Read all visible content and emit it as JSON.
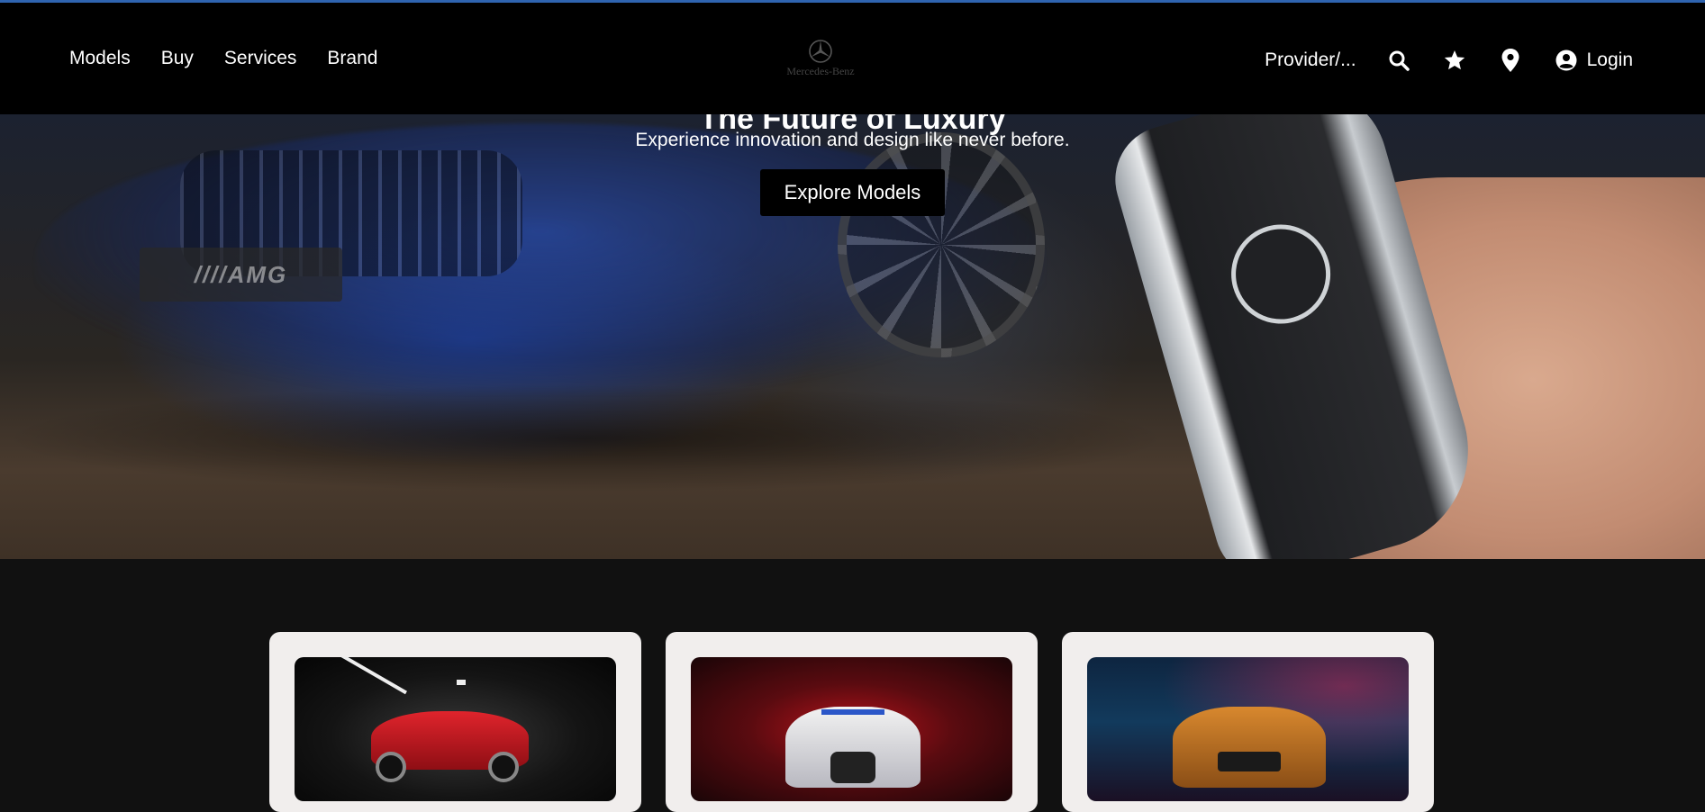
{
  "nav": {
    "links": [
      "Models",
      "Buy",
      "Services",
      "Brand"
    ],
    "logo_text": "Mercedes-Benz",
    "provider": "Provider/...",
    "login": "Login"
  },
  "hero": {
    "title": "The Future of Luxury",
    "subtitle": "Experience innovation and design like never before.",
    "button": "Explore Models",
    "plate_text": "////AMG"
  },
  "cards": [
    {
      "image": "red-sports-car"
    },
    {
      "image": "white-race-car"
    },
    {
      "image": "orange-muscle-car"
    }
  ],
  "icons": [
    "search-icon",
    "star-icon",
    "location-pin-icon",
    "account-circle-icon"
  ],
  "colors": {
    "accent": "#2f64b0",
    "navbar": "#000000",
    "page_bg": "#111111",
    "card_bg": "#f1eeed"
  }
}
